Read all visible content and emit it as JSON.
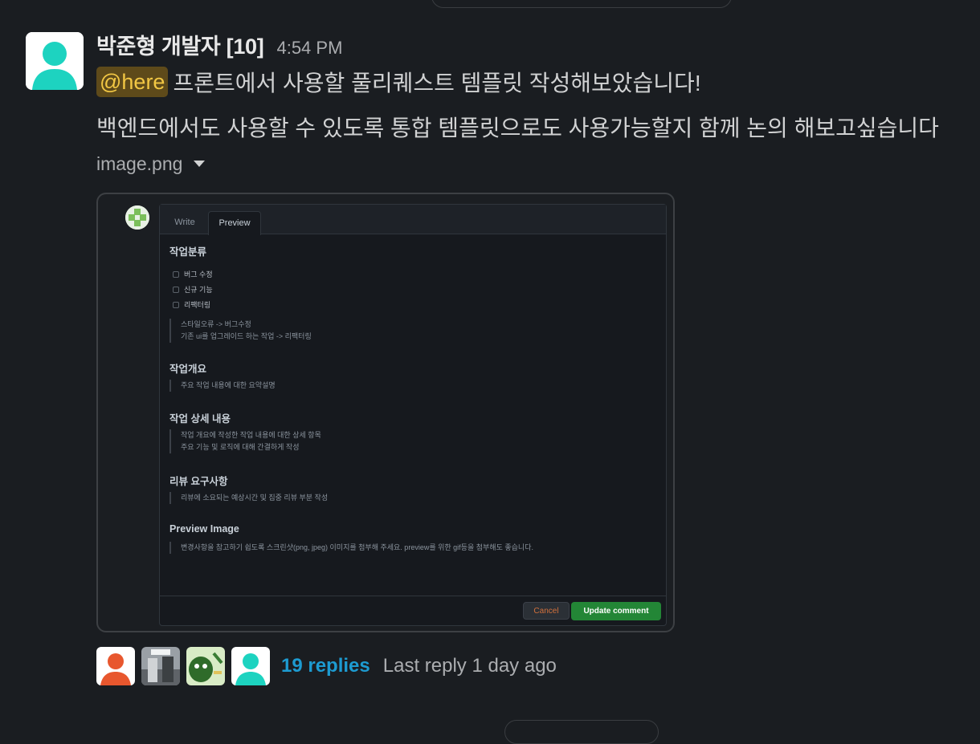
{
  "message": {
    "author": "박준형 개발자 [10]",
    "timestamp": "4:54 PM",
    "mention": "@here",
    "line1": "프론트에서 사용할 풀리퀘스트 템플릿 작성해보았습니다!",
    "line2": "백엔드에서도 사용할 수 있도록 통합 템플릿으로도 사용가능할지 함께 논의 해보고싶습니다",
    "file_name": "image.png"
  },
  "preview": {
    "tabs": [
      "Write",
      "Preview"
    ],
    "active_tab": "Preview",
    "sections": {
      "work_type": {
        "heading": "작업분류",
        "checkboxes": [
          "버그 수정",
          "신규 기능",
          "리팩터링"
        ],
        "quote_lines": [
          "스타일오류 -> 버그수정",
          "기존 ui를 업그레이드 하는 작업 -> 리팩터링"
        ]
      },
      "summary": {
        "heading": "작업개요",
        "quote_lines": [
          "주요 작업 내용에 대한 요약설명"
        ]
      },
      "details": {
        "heading": "작업 상세 내용",
        "quote_lines": [
          "작업 개요에 작성한 작업 내용에 대한 상세 항목",
          "주요 기능 및 로직에 대해 간결하게 작성"
        ]
      },
      "review": {
        "heading": "리뷰 요구사항",
        "quote_lines": [
          "리뷰에 소요되는 예상시간 및 집중 리뷰 부분 작성"
        ]
      },
      "image": {
        "heading": "Preview Image",
        "quote_lines": [
          "변경사항을 참고하기 쉽도록 스크린샷(png, jpeg) 이미지를 첨부해 주세요. preview를 위한 gif등을 첨부해도 좋습니다."
        ]
      }
    },
    "buttons": {
      "cancel": "Cancel",
      "update": "Update comment"
    }
  },
  "thread": {
    "replies_label": "19 replies",
    "last_reply": "Last reply 1 day ago"
  },
  "colors": {
    "mention_bg": "#5e4a1a",
    "mention_fg": "#f2c744",
    "link": "#1d9bd1",
    "update_button": "#238636",
    "avatar_teal": "#1dd3c0",
    "avatar_orange": "#e8572e"
  }
}
